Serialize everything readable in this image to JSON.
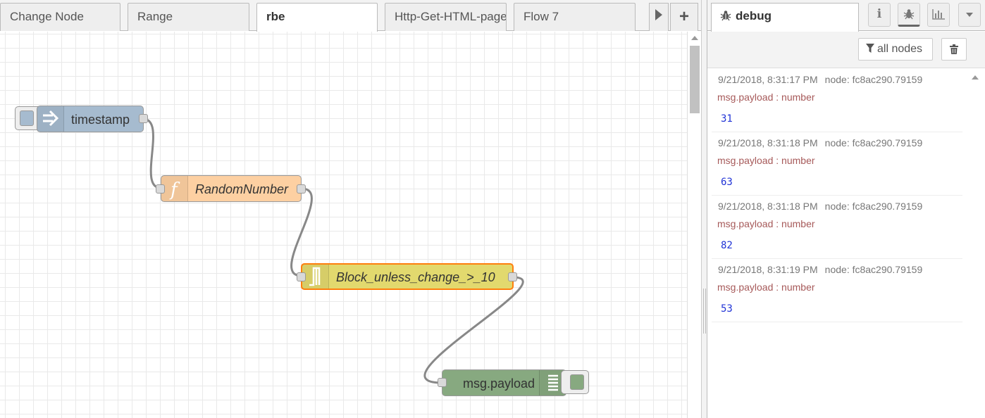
{
  "workspace": {
    "tabs": [
      {
        "label": "Change Node"
      },
      {
        "label": "Range"
      },
      {
        "label": "rbe"
      },
      {
        "label": "Http-Get-HTML-page"
      },
      {
        "label": "Flow 7"
      }
    ],
    "add_tab_label": "+"
  },
  "flow": {
    "nodes": [
      {
        "label": "timestamp",
        "type": "inject",
        "color": "#a6bbcf"
      },
      {
        "label": "RandomNumber",
        "type": "function",
        "color": "#fdd0a2"
      },
      {
        "label": "Block_unless_change_>_10",
        "type": "rbe",
        "color": "#e2d96e"
      },
      {
        "label": "msg.payload",
        "type": "debug",
        "color": "#87a980"
      }
    ]
  },
  "sidebar": {
    "tab_label": "debug",
    "filter_label": "all nodes",
    "messages": [
      {
        "timestamp": "9/21/2018, 8:31:17 PM",
        "node": "node: fc8ac290.79159",
        "type_label": "msg.payload : number",
        "value": "31"
      },
      {
        "timestamp": "9/21/2018, 8:31:18 PM",
        "node": "node: fc8ac290.79159",
        "type_label": "msg.payload : number",
        "value": "63"
      },
      {
        "timestamp": "9/21/2018, 8:31:18 PM",
        "node": "node: fc8ac290.79159",
        "type_label": "msg.payload : number",
        "value": "82"
      },
      {
        "timestamp": "9/21/2018, 8:31:19 PM",
        "node": "node: fc8ac290.79159",
        "type_label": "msg.payload : number",
        "value": "53"
      }
    ]
  },
  "colors": {
    "wire": "#888888",
    "selected_outline": "#ff7f0e",
    "debug_value": "#2033d6",
    "debug_type": "#a65959"
  }
}
